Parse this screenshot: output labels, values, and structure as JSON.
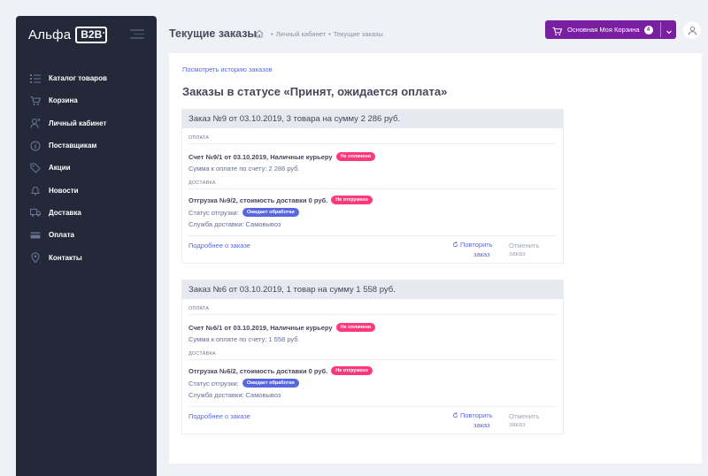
{
  "brand": {
    "name": "Альфа",
    "badge": "B2B"
  },
  "sidebar": {
    "items": [
      {
        "label": "Каталог товаров",
        "icon": "list-icon"
      },
      {
        "label": "Корзина",
        "icon": "cart-icon"
      },
      {
        "label": "Личный кабинет",
        "icon": "user-icon"
      },
      {
        "label": "Поставщикам",
        "icon": "info-icon"
      },
      {
        "label": "Акции",
        "icon": "tag-icon"
      },
      {
        "label": "Новости",
        "icon": "bell-icon"
      },
      {
        "label": "Доставка",
        "icon": "truck-icon"
      },
      {
        "label": "Оплата",
        "icon": "card-icon"
      },
      {
        "label": "Контакты",
        "icon": "location-icon"
      }
    ]
  },
  "header": {
    "title": "Текущие заказы",
    "breadcrumb": [
      "Личный кабинет",
      "Текущие заказы"
    ],
    "cart_label": "Основная Моя Корзина",
    "cart_count": "4"
  },
  "main": {
    "history_link": "Посмотреть историю заказов",
    "heading": "Заказы в статусе «Принят, ожидается оплата»",
    "orders": [
      {
        "title": "Заказ №9 от 03.10.2019, 3 товара на сумму 2 286 руб.",
        "payment_label": "ОПЛАТА",
        "invoice": "Счет №9/1 от 03.10.2019, Наличные курьеру",
        "invoice_badge": "Не оплачено",
        "amount": "Сумма к оплате по счету: 2 286 руб.",
        "delivery_label": "ДОСТАВКА",
        "shipment": "Отгрузка №9/2, стоимость доставки 0 руб.",
        "shipment_badge": "Не отгружено",
        "status_label": "Статус отгрузки:",
        "status_badge": "Ожидает обработки",
        "service": "Служба доставки: Самовывоз",
        "more": "Подробнее о заказе",
        "repeat_1": "Повторить",
        "repeat_2": "заказ",
        "cancel": "Отменить заказ"
      },
      {
        "title": "Заказ №6 от 03.10.2019, 1 товар на сумму 1 558 руб.",
        "payment_label": "ОПЛАТА",
        "invoice": "Счет №6/1 от 03.10.2019, Наличные курьеру",
        "invoice_badge": "Не оплачено",
        "amount": "Сумма к оплате по счету: 1 558 руб.",
        "delivery_label": "ДОСТАВКА",
        "shipment": "Отгрузка №6/2, стоимость доставки 0 руб.",
        "shipment_badge": "Не отгружено",
        "status_label": "Статус отгрузки:",
        "status_badge": "Ожидает обработки",
        "service": "Служба доставки: Самовывоз",
        "more": "Подробнее о заказе",
        "repeat_1": "Повторить",
        "repeat_2": "заказ",
        "cancel": "Отменить заказ"
      }
    ]
  },
  "colors": {
    "sidebar_bg": "#242939",
    "accent": "#7b1fa2",
    "link": "#5867dd",
    "badge_red": "#fd397a",
    "badge_blue": "#5867dd"
  }
}
